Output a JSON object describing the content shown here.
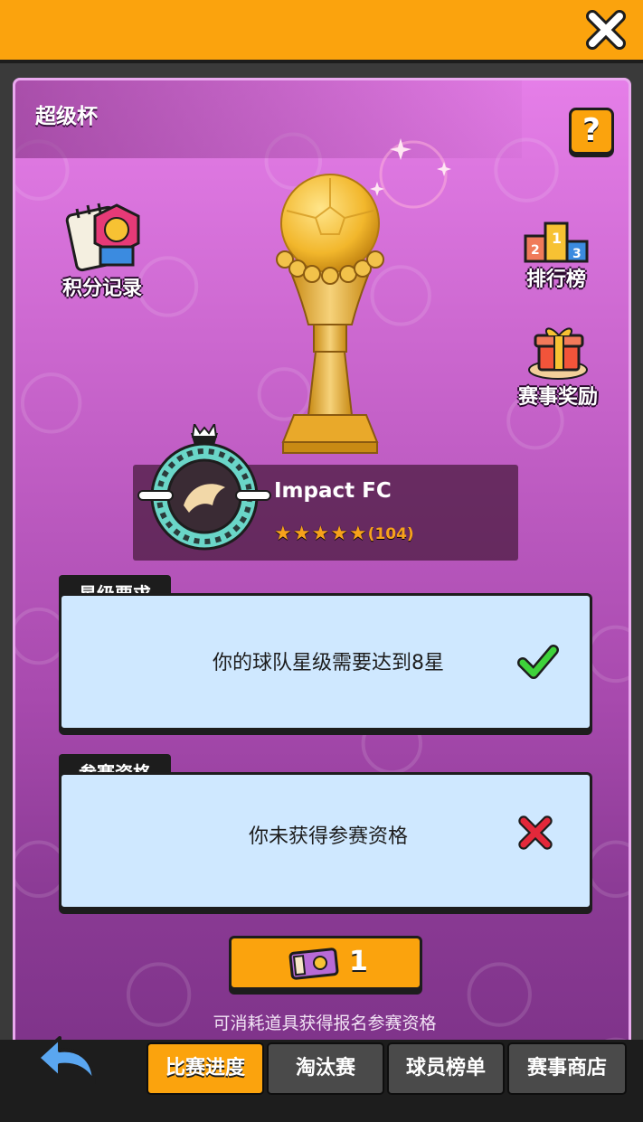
{
  "header": {
    "close_icon": "close-x-icon"
  },
  "title": "超级杯",
  "help_label": "?",
  "side_buttons": {
    "points_record": "积分记录",
    "leaderboard": "排行榜",
    "rewards": "赛事奖励"
  },
  "team": {
    "name": "Impact FC",
    "stars_filled": 5,
    "rating": "(104)"
  },
  "requirements": [
    {
      "tab": "星级要求",
      "text": "你的球队星级需要达到8星",
      "status": "met",
      "icon": "check-icon"
    },
    {
      "tab": "参赛资格",
      "text": "你未获得参赛资格",
      "status": "unmet",
      "icon": "cross-icon"
    }
  ],
  "ticket": {
    "count": "1",
    "icon": "ticket-icon"
  },
  "hint": "可消耗道具获得报名参赛资格",
  "tabs": [
    {
      "label": "比赛进度",
      "active": true
    },
    {
      "label": "淘汰赛",
      "active": false
    },
    {
      "label": "球员榜单",
      "active": false
    },
    {
      "label": "赛事商店",
      "active": false
    }
  ],
  "colors": {
    "accent": "#fba30d",
    "panel_top": "#e57ee8",
    "panel_bottom": "#7b3186",
    "box": "#cfe8ff",
    "dark": "#1d1d1d"
  }
}
